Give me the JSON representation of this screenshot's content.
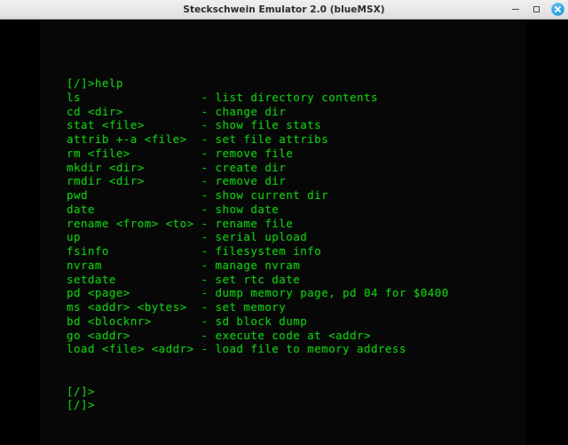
{
  "window": {
    "title": "Steckschwein Emulator 2.0 (blueMSX)",
    "controls": {
      "minimize_label": "–",
      "maximize_label": "□",
      "close_label": "×"
    }
  },
  "theme": {
    "titlebar_bg": "#e7e7e6",
    "titlebar_text": "#2d2d2d",
    "close_button_bg": "#2aa2e0",
    "screen_bg": "#070707",
    "window_bg": "#000000",
    "terminal_green": "#13c413"
  },
  "terminal": {
    "prompt": "[/]>",
    "command_entered": "help",
    "prompt_line": "[/]>help",
    "columns": 60,
    "help_entries": [
      {
        "command": "ls",
        "dash": "-",
        "description": "list directory contents"
      },
      {
        "command": "cd <dir>",
        "dash": "-",
        "description": "change dir"
      },
      {
        "command": "stat <file>",
        "dash": "-",
        "description": "show file stats"
      },
      {
        "command": "attrib +-a <file>",
        "dash": "-",
        "description": "set file attribs"
      },
      {
        "command": "rm <file>",
        "dash": "-",
        "description": "remove file"
      },
      {
        "command": "mkdir <dir>",
        "dash": "-",
        "description": "create dir"
      },
      {
        "command": "rmdir <dir>",
        "dash": "-",
        "description": "remove dir"
      },
      {
        "command": "pwd",
        "dash": "-",
        "description": "show current dir"
      },
      {
        "command": "date",
        "dash": "-",
        "description": "show date"
      },
      {
        "command": "rename <from> <to>",
        "dash": "-",
        "description": "rename file"
      },
      {
        "command": "up",
        "dash": "-",
        "description": "serial upload"
      },
      {
        "command": "fsinfo",
        "dash": "-",
        "description": "filesystem info"
      },
      {
        "command": "nvram",
        "dash": "-",
        "description": "manage nvram"
      },
      {
        "command": "setdate",
        "dash": "-",
        "description": "set rtc date"
      },
      {
        "command": "pd <page>",
        "dash": "-",
        "description": "dump memory page, pd 04 for $0400"
      },
      {
        "command": "ms <addr> <bytes>",
        "dash": "-",
        "description": "set memory"
      },
      {
        "command": "bd <blocknr>",
        "dash": "-",
        "description": "sd block dump"
      },
      {
        "command": "go <addr>",
        "dash": "-",
        "description": "execute code at <addr>"
      },
      {
        "command": "load <file> <addr>",
        "dash": "-",
        "description": "load file to memory address"
      }
    ],
    "trailing_prompts": [
      "[/]>",
      "[/]>"
    ],
    "blank_lines_before_prompts": 2
  }
}
